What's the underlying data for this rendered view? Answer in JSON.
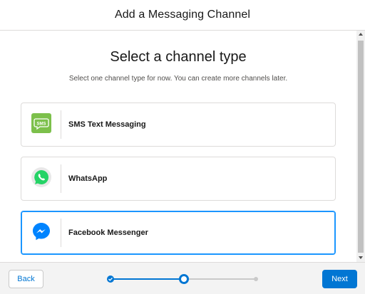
{
  "header": {
    "title": "Add a Messaging Channel"
  },
  "main": {
    "title": "Select a channel type",
    "subtitle": "Select one channel type for now. You can create more channels later.",
    "channels": [
      {
        "label": "SMS Text Messaging",
        "icon": "sms-icon",
        "selected": false,
        "color": "#7cc04b"
      },
      {
        "label": "WhatsApp",
        "icon": "whatsapp-icon",
        "selected": false,
        "color": "#25d366"
      },
      {
        "label": "Facebook Messenger",
        "icon": "messenger-icon",
        "selected": true,
        "color": "#0084ff"
      }
    ],
    "sms_icon_text": "SMS"
  },
  "footer": {
    "back_label": "Back",
    "next_label": "Next",
    "progress": {
      "total_steps": 3,
      "current_step": 2
    }
  },
  "colors": {
    "brand": "#0176d3",
    "selected_border": "#1b96ff"
  }
}
